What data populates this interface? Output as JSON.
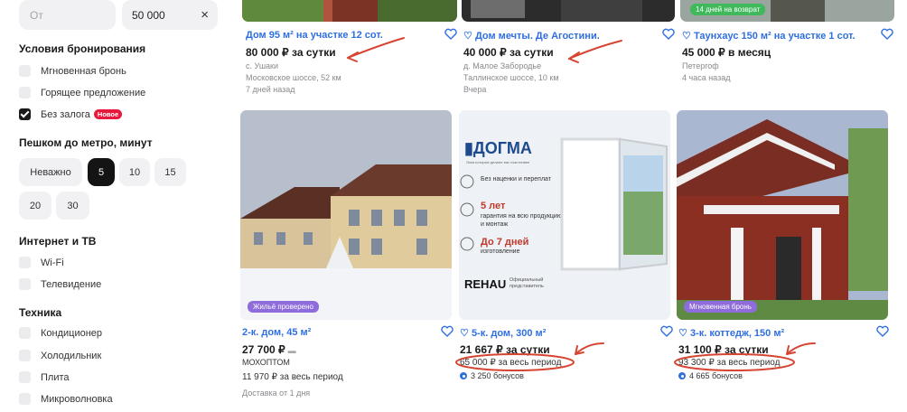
{
  "price_filter": {
    "from_placeholder": "От",
    "to_value": "50 000",
    "clear_icon": "×"
  },
  "booking": {
    "title": "Условия бронирования",
    "options": [
      {
        "label": "Мгновенная бронь",
        "checked": false
      },
      {
        "label": "Горящее предложение",
        "checked": false
      },
      {
        "label": "Без залога",
        "checked": true,
        "badge": "Новое"
      }
    ]
  },
  "metro": {
    "title": "Пешком до метро, минут",
    "chips": [
      "Неважно",
      "5",
      "10",
      "15",
      "20",
      "30"
    ],
    "active": "5"
  },
  "internet": {
    "title": "Интернет и ТВ",
    "options": [
      "Wi-Fi",
      "Телевидение"
    ]
  },
  "tech": {
    "title": "Техника",
    "options": [
      "Кондиционер",
      "Холодильник",
      "Плита",
      "Микроволновка"
    ]
  },
  "cards_top": [
    {
      "title": "Дом 95 м² на участке 12 сот.",
      "price": "80 000 ₽ за сутки",
      "place": "с. Ушаки",
      "road": "Московское шоссе, 52 км",
      "time": "7 дней назад"
    },
    {
      "title": "Дом мечты. Де Агостини.",
      "price": "40 000 ₽ за сутки",
      "place": "д. Малое Забородье",
      "road": "Таллинское шоссе, 10 км",
      "time": "Вчера"
    },
    {
      "title": "Таунхаус 150 м² на участке 1 сот.",
      "price": "45 000 ₽ в месяц",
      "place": "Петергоф",
      "time": "4 часа назад",
      "photo_badge": "14 дней на возврат"
    }
  ],
  "cards_bottom": [
    {
      "title": "2-к. дом, 45 м²",
      "price": "27 700 ₽",
      "seller": "МОХОПТОМ",
      "period": "11 970 ₽ за весь период",
      "delivery": "Доставка от 1 дня",
      "photo_badge": "Жильё проверено"
    },
    {
      "title": "5-к. дом, 300 м²",
      "price": "21 667 ₽ за сутки",
      "period": "65 000 ₽ за весь период",
      "bonus": "3 250 бонусов"
    },
    {
      "title": "3-к. коттедж, 150 м²",
      "price": "31 100 ₽ за сутки",
      "period": "93 300 ₽ за весь период",
      "bonus": "4 665 бонусов",
      "photo_badge": "Мгновенная бронь"
    }
  ],
  "ad": {
    "brand": "ДОГМА",
    "tagline": "Окна которые делают вас счастливее",
    "points": [
      "Без наценки и переплат",
      "5 лет",
      "гарантия на всю продукцию и монтаж",
      "До 7 дней",
      "изготовление"
    ],
    "partner": "REHAU",
    "partner_note": "Официальный представитель"
  },
  "colors": {
    "link": "#2f6fe0",
    "annotation": "#d64531",
    "active_chip": "#141414"
  }
}
